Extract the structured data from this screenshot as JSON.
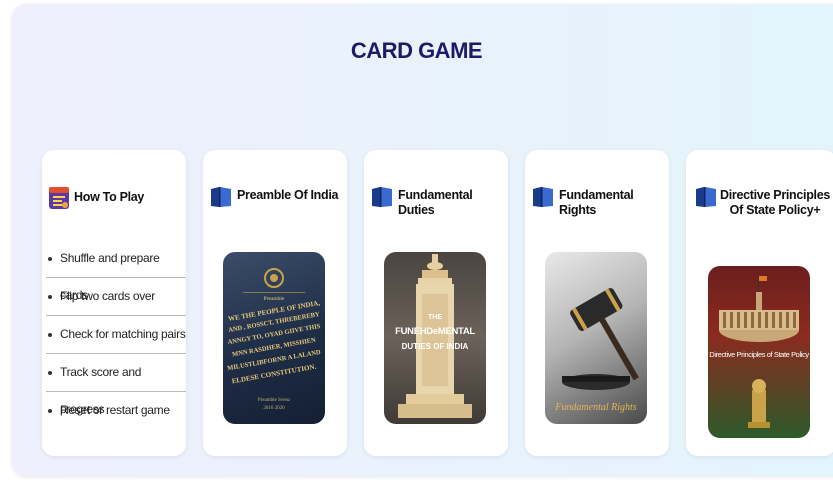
{
  "title": "CARD GAME",
  "how_to_play": {
    "title": "How To Play",
    "icon": "how-to-play-icon",
    "steps": [
      "Shuffle and prepare cards",
      "Flip two cards over",
      "Check for matching pairs",
      "Track score and progress",
      "Reset or restart game"
    ]
  },
  "cards": [
    {
      "title": "Preamble Of India",
      "icon": "book-icon",
      "image_text": {
        "line1": "Preamble",
        "line2": "WE THE PEOPLE OF INDIA,",
        "line3": "AND , ROSSCT, THREBEREBY",
        "line4": "ANNGY TO, OYAD GIIVE THIS",
        "line5": "MNN RASDHER, MISSHIEN",
        "line6": "MILUSTLIBFORNR A LALAND",
        "line7": "ELDESE CONSTITUTION.",
        "line8": "Preamble Svenz",
        "line9": "2016 2020"
      }
    },
    {
      "title": "Fundamental Duties",
      "icon": "book-icon",
      "image_text": {
        "line1": "THE",
        "line2": "FUNEHDeMENTAL",
        "line3": "DUTIES OF INDIA"
      }
    },
    {
      "title": "Fundamental Rights",
      "icon": "book-icon",
      "image_text": {
        "line1": "Fundamental Rights"
      }
    },
    {
      "title_line1": "Directive Principles",
      "title_line2": "Of State Policy+",
      "icon": "book-icon",
      "image_text": {
        "line1": "Directive Principles of State Policy"
      }
    }
  ],
  "colors": {
    "title": "#1f1a66",
    "book": "#1a3a8a",
    "card_bg": "#ffffff",
    "panel_bg": "#eaf1fb"
  }
}
